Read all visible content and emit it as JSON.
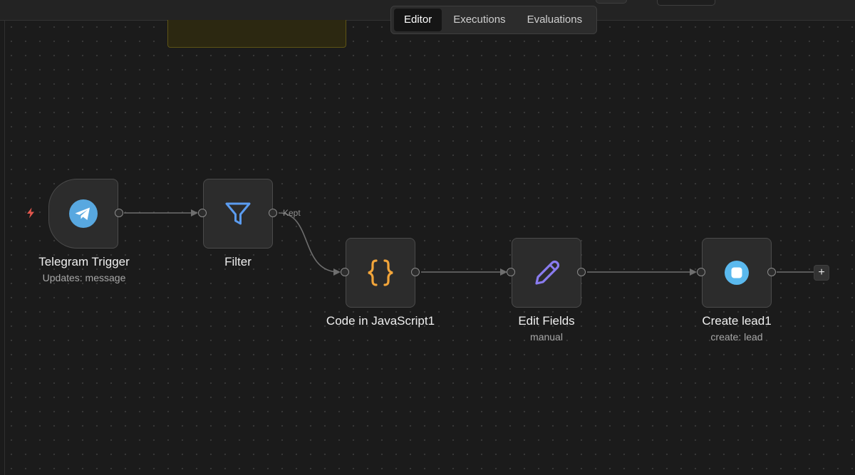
{
  "tabs": {
    "items": [
      {
        "label": "Editor",
        "active": true
      },
      {
        "label": "Executions",
        "active": false
      },
      {
        "label": "Evaluations",
        "active": false
      }
    ]
  },
  "nodes": {
    "telegram": {
      "title": "Telegram Trigger",
      "subtitle": "Updates: message",
      "icon": "telegram-icon"
    },
    "filter": {
      "title": "Filter",
      "output_label": "Kept",
      "icon": "funnel-icon"
    },
    "code": {
      "title": "Code in JavaScript1",
      "icon": "code-braces-icon"
    },
    "edit": {
      "title": "Edit Fields",
      "subtitle": "manual",
      "icon": "pencil-icon"
    },
    "create": {
      "title": "Create lead1",
      "subtitle": "create: lead",
      "icon": "app-icon"
    }
  },
  "add_button": {
    "label": "+"
  },
  "colors": {
    "telegram": "#58a8e0",
    "filter": "#5b9cf0",
    "code": "#f2a53a",
    "edit": "#8a7cf0",
    "create": "#5ab9ee",
    "trigger_bolt": "#e3574d",
    "edge": "#6e6e6e"
  }
}
